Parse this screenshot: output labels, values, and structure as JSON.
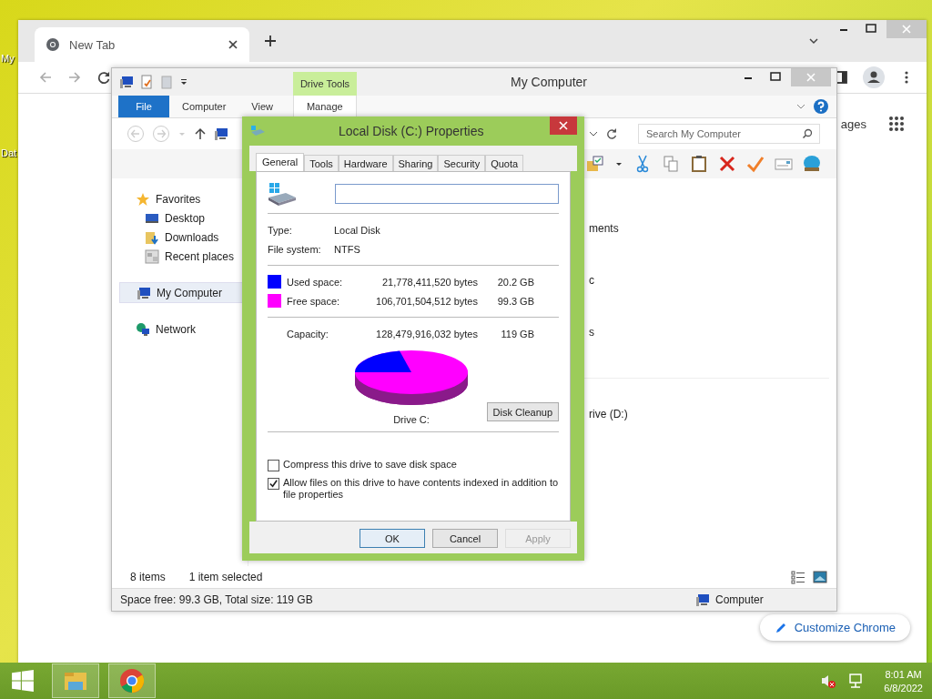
{
  "desktop": {
    "icon_labels": [
      "My",
      "Dat"
    ]
  },
  "browser": {
    "tab": {
      "title": "New Tab",
      "selected": true
    },
    "page_link_fragment": "ages",
    "customize_button": "Customize Chrome"
  },
  "explorer": {
    "title": "My Computer",
    "context_group": "Drive Tools",
    "ribbon_tabs": [
      {
        "label": "File",
        "kind": "file"
      },
      {
        "label": "Computer",
        "kind": "tab"
      },
      {
        "label": "View",
        "kind": "tab"
      },
      {
        "label": "Manage",
        "kind": "context"
      }
    ],
    "search": {
      "placeholder": "Search My Computer"
    },
    "nav": [
      {
        "label": "Favorites",
        "selected": false,
        "children": [
          {
            "label": "Desktop",
            "selected": false
          },
          {
            "label": "Downloads",
            "selected": false
          },
          {
            "label": "Recent places",
            "selected": false
          }
        ]
      },
      {
        "label": "My Computer",
        "selected": true
      },
      {
        "label": "Network",
        "selected": false
      }
    ],
    "content_fragments": [
      "ments",
      "c",
      "s",
      "rive (D:)"
    ],
    "status": {
      "count": "8 items",
      "selection": "1 item selected"
    },
    "details": {
      "space": "Space free: 99.3 GB, Total size: 119 GB",
      "location": "Computer"
    }
  },
  "dialog": {
    "title": "Local Disk (C:) Properties",
    "tabs": [
      {
        "label": "General",
        "selected": true
      },
      {
        "label": "Tools",
        "selected": false
      },
      {
        "label": "Hardware",
        "selected": false
      },
      {
        "label": "Sharing",
        "selected": false
      },
      {
        "label": "Security",
        "selected": false
      },
      {
        "label": "Quota",
        "selected": false
      }
    ],
    "info": [
      {
        "label": "Type:",
        "value": "Local Disk"
      },
      {
        "label": "File system:",
        "value": "NTFS"
      }
    ],
    "space": [
      {
        "label": "Used space:",
        "bytes": "21,778,411,520 bytes",
        "size": "20.2 GB",
        "color": "#0000ff"
      },
      {
        "label": "Free space:",
        "bytes": "106,701,504,512 bytes",
        "size": "99.3 GB",
        "color": "#ff00ff"
      }
    ],
    "capacity": {
      "label": "Capacity:",
      "bytes": "128,479,916,032 bytes",
      "size": "119 GB"
    },
    "drive_label": "Drive C:",
    "cleanup_button": "Disk Cleanup",
    "options": [
      {
        "label": "Compress this drive to save disk space",
        "checked": false
      },
      {
        "label": "Allow files on this drive to have contents indexed in addition to file properties",
        "checked": true
      }
    ],
    "buttons": [
      {
        "label": "OK",
        "disabled": false,
        "default": true
      },
      {
        "label": "Cancel",
        "disabled": false,
        "default": false
      },
      {
        "label": "Apply",
        "disabled": true,
        "default": false
      }
    ]
  },
  "taskbar": {
    "time": "8:01 AM",
    "date": "6/8/2022"
  }
}
